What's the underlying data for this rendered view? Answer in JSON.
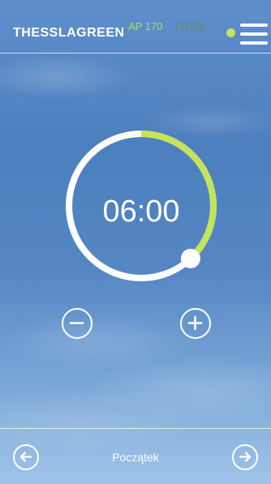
{
  "header": {
    "brand": "THESSLAGREEN",
    "model": "AP 170",
    "serial": "(1163)",
    "status_color": "#c4e35a",
    "menu_icon": "hamburger-menu-icon"
  },
  "timer": {
    "display": "06:00",
    "progress_fraction": 0.38,
    "progress_color": "#c4e35a",
    "track_color": "#ffffff",
    "decrease_icon": "minus-icon",
    "increase_icon": "plus-icon"
  },
  "footer": {
    "label": "Początek",
    "prev_icon": "arrow-left-icon",
    "next_icon": "arrow-right-icon"
  }
}
